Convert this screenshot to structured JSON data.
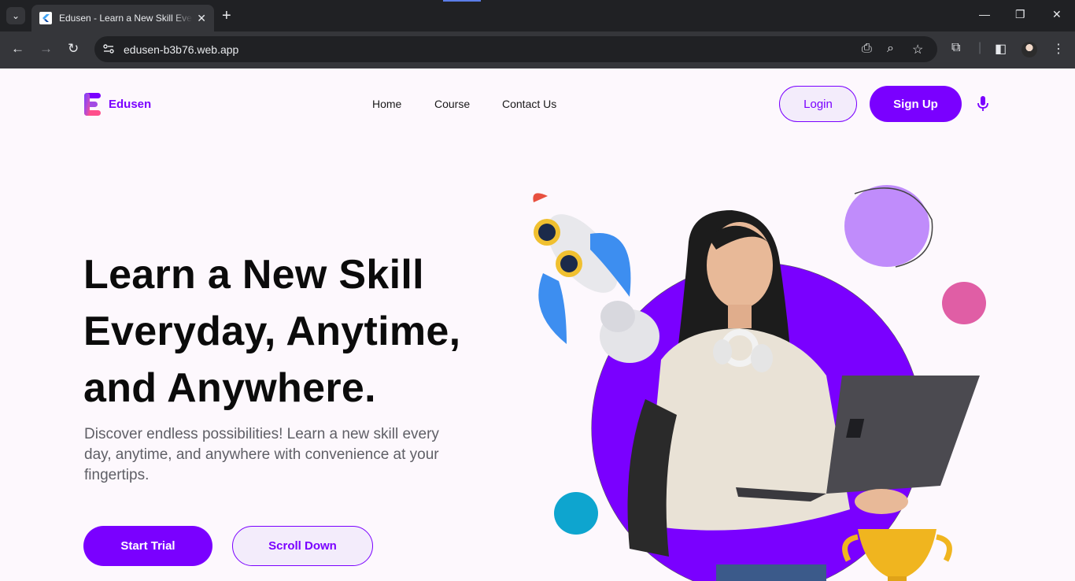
{
  "browser": {
    "tab_title": "Edusen - Learn a New Skill Everyday",
    "url": "edusen-b3b76.web.app"
  },
  "site": {
    "brand": "Edusen",
    "brand_color": "#7a00ff",
    "nav": {
      "home": "Home",
      "course": "Course",
      "contact": "Contact Us"
    },
    "login_label": "Login",
    "signup_label": "Sign Up"
  },
  "hero": {
    "headline_line1": "Learn a New Skill",
    "headline_line2": "Everyday, Anytime,",
    "headline_line3": "and Anywhere.",
    "lead": "Discover endless possibilities! Learn a new skill every day, anytime, and anywhere with convenience at your fingertips.",
    "start_trial_label": "Start Trial",
    "scroll_down_label": "Scroll Down"
  },
  "icons": {
    "tab_list": "chevron-down-icon",
    "back": "arrow-left-icon",
    "forward": "arrow-right-icon",
    "reload": "reload-icon",
    "site_settings": "tune-icon",
    "install": "install-app-icon",
    "zoom": "zoom-icon",
    "bookmark": "star-icon",
    "extensions": "puzzle-icon",
    "side_panel": "side-panel-icon",
    "menu": "kebab-menu-icon",
    "mic": "microphone-icon"
  }
}
